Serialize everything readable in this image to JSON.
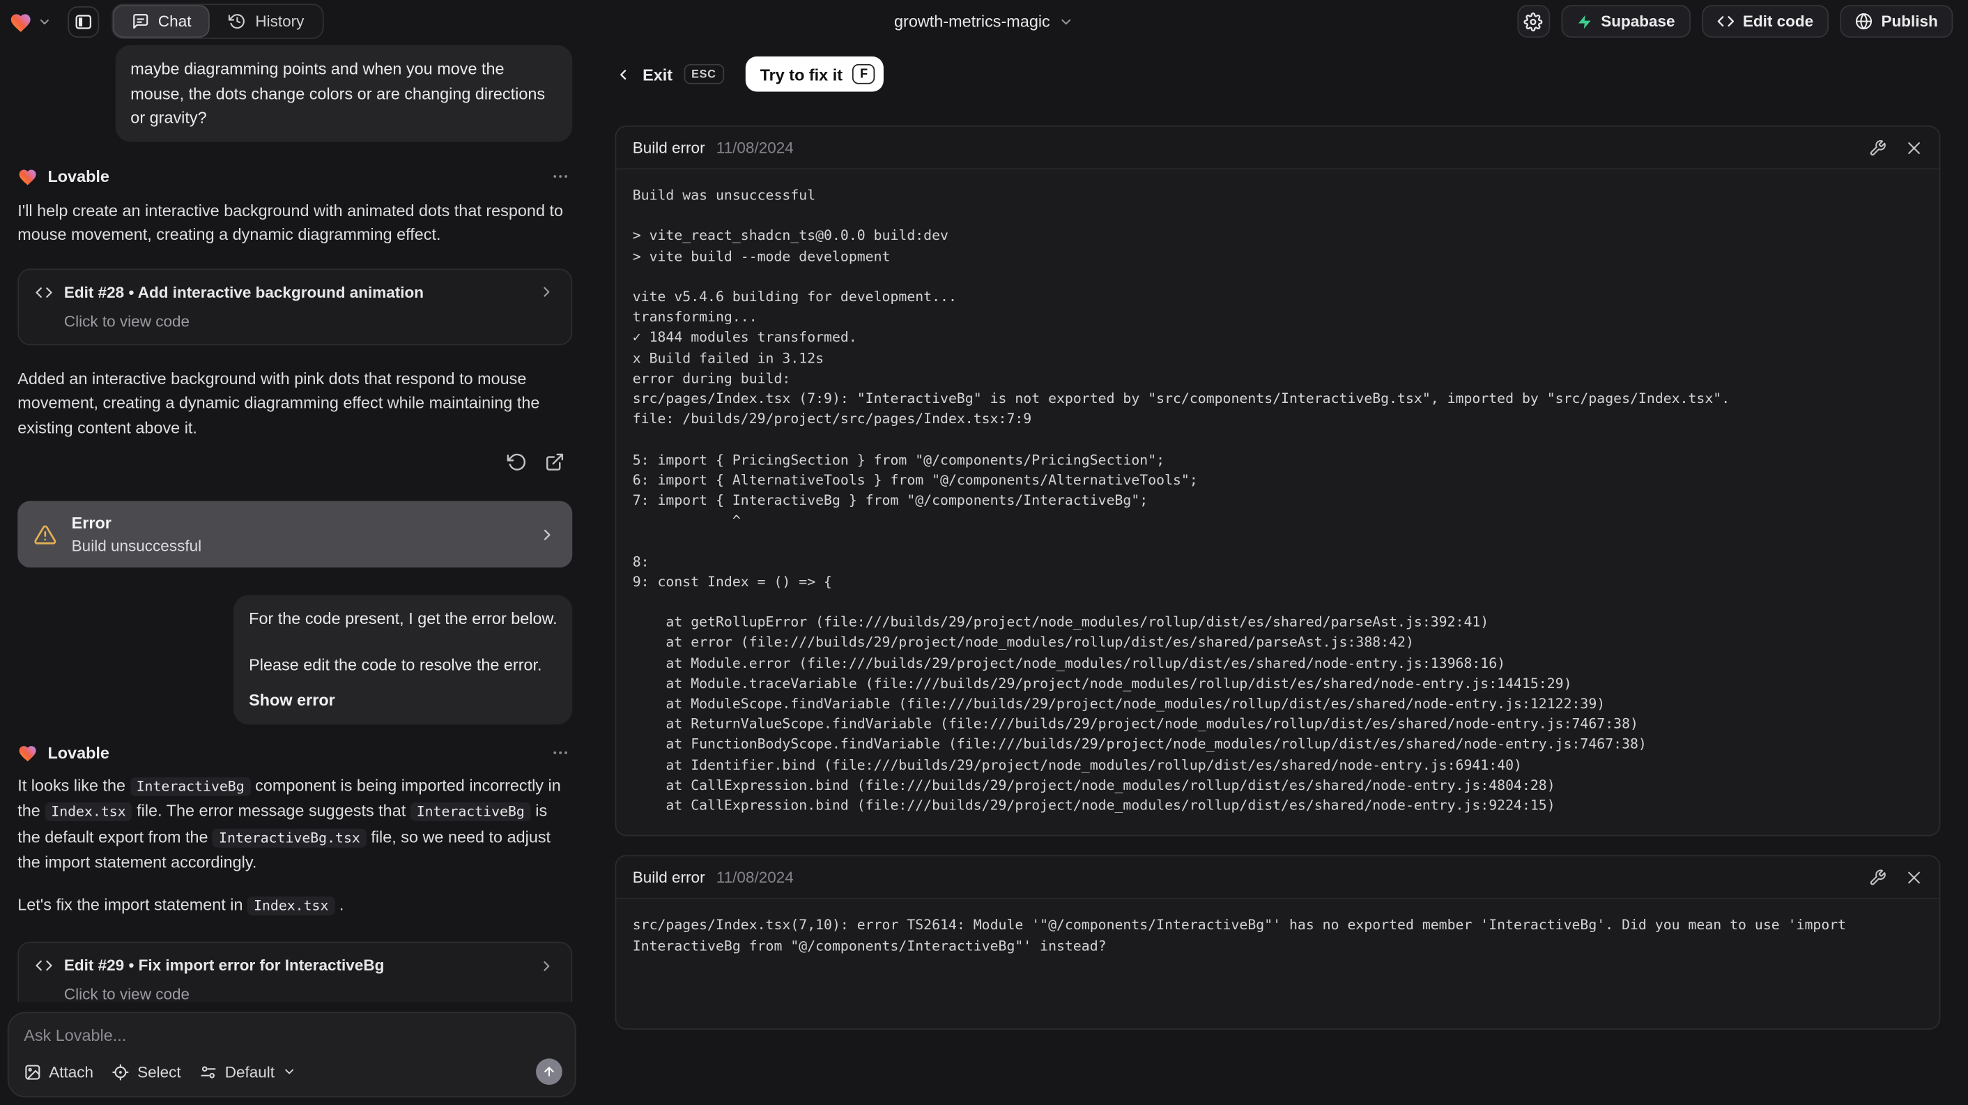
{
  "topbar": {
    "project_name": "growth-metrics-magic",
    "tabs": {
      "chat": "Chat",
      "history": "History"
    },
    "supabase_label": "Supabase",
    "edit_code_label": "Edit code",
    "publish_label": "Publish"
  },
  "colors": {
    "supabase_green": "#3ecf8e",
    "warning_yellow": "#e5b054",
    "fix_button_bg": "#ffffff"
  },
  "icons": {
    "logo": "heart-icon",
    "sidebar": "panel-left-icon",
    "chat_tab": "chat-bubble-icon",
    "history_tab": "history-icon",
    "settings": "gear-icon",
    "supabase": "zap-icon",
    "edit_code": "code-icon",
    "publish": "globe-icon",
    "repair": "wrench-icon",
    "close": "x-icon"
  },
  "chat": {
    "assistant_name": "Lovable",
    "user_message_1": "maybe diagramming points and when you move the mouse, the dots change colors or are changing directions or gravity?",
    "assistant_intro": "I'll help create an interactive background with animated dots that respond to mouse movement, creating a dynamic diagramming effect.",
    "edit_card_1": {
      "title": "Edit #28 • Add interactive background animation",
      "subtitle": "Click to view code"
    },
    "assistant_summary": "Added an interactive background with pink dots that respond to mouse movement, creating a dynamic diagramming effect while maintaining the existing content above it.",
    "error_card": {
      "title": "Error",
      "subtitle": "Build unsuccessful"
    },
    "user_message_2": {
      "para1": "For the code present, I get the error below.",
      "para2": "Please edit the code to resolve the error.",
      "action": "Show error"
    },
    "assistant_fix_explanation": [
      {
        "t": "text",
        "v": "It looks like the "
      },
      {
        "t": "code",
        "v": "InteractiveBg"
      },
      {
        "t": "text",
        "v": " component is being imported incorrectly in the "
      },
      {
        "t": "code",
        "v": "Index.tsx"
      },
      {
        "t": "text",
        "v": " file. The error message suggests that "
      },
      {
        "t": "code",
        "v": "InteractiveBg"
      },
      {
        "t": "text",
        "v": " is the default export from the "
      },
      {
        "t": "code",
        "v": "InteractiveBg.tsx"
      },
      {
        "t": "text",
        "v": " file, so we need to adjust the import statement accordingly."
      }
    ],
    "assistant_fix_line": [
      {
        "t": "text",
        "v": "Let's fix the import statement in "
      },
      {
        "t": "code",
        "v": "Index.tsx"
      },
      {
        "t": "text",
        "v": " ."
      }
    ],
    "edit_card_2": {
      "title": "Edit #29 • Fix import error for InteractiveBg",
      "subtitle": "Click to view code"
    },
    "composer": {
      "placeholder": "Ask Lovable...",
      "attach_label": "Attach",
      "select_label": "Select",
      "mode_label": "Default"
    }
  },
  "error_panel": {
    "exit_label": "Exit",
    "esc_key": "ESC",
    "fix_label": "Try to fix it",
    "fix_key": "F",
    "cards": [
      {
        "title": "Build error",
        "date": "11/08/2024",
        "log": [
          "Build was unsuccessful",
          "",
          "> vite_react_shadcn_ts@0.0.0 build:dev",
          "> vite build --mode development",
          "",
          "vite v5.4.6 building for development...",
          "transforming...",
          "✓ 1844 modules transformed.",
          "x Build failed in 3.12s",
          "error during build:",
          "src/pages/Index.tsx (7:9): \"InteractiveBg\" is not exported by \"src/components/InteractiveBg.tsx\", imported by \"src/pages/Index.tsx\".",
          "file: /builds/29/project/src/pages/Index.tsx:7:9",
          "",
          "5: import { PricingSection } from \"@/components/PricingSection\";",
          "6: import { AlternativeTools } from \"@/components/AlternativeTools\";",
          "7: import { InteractiveBg } from \"@/components/InteractiveBg\";",
          "            ^",
          "",
          "8: ",
          "9: const Index = () => {",
          "",
          "    at getRollupError (file:///builds/29/project/node_modules/rollup/dist/es/shared/parseAst.js:392:41)",
          "    at error (file:///builds/29/project/node_modules/rollup/dist/es/shared/parseAst.js:388:42)",
          "    at Module.error (file:///builds/29/project/node_modules/rollup/dist/es/shared/node-entry.js:13968:16)",
          "    at Module.traceVariable (file:///builds/29/project/node_modules/rollup/dist/es/shared/node-entry.js:14415:29)",
          "    at ModuleScope.findVariable (file:///builds/29/project/node_modules/rollup/dist/es/shared/node-entry.js:12122:39)",
          "    at ReturnValueScope.findVariable (file:///builds/29/project/node_modules/rollup/dist/es/shared/node-entry.js:7467:38)",
          "    at FunctionBodyScope.findVariable (file:///builds/29/project/node_modules/rollup/dist/es/shared/node-entry.js:7467:38)",
          "    at Identifier.bind (file:///builds/29/project/node_modules/rollup/dist/es/shared/node-entry.js:6941:40)",
          "    at CallExpression.bind (file:///builds/29/project/node_modules/rollup/dist/es/shared/node-entry.js:4804:28)",
          "    at CallExpression.bind (file:///builds/29/project/node_modules/rollup/dist/es/shared/node-entry.js:9224:15)"
        ]
      },
      {
        "title": "Build error",
        "date": "11/08/2024",
        "log": [
          "src/pages/Index.tsx(7,10): error TS2614: Module '\"@/components/InteractiveBg\"' has no exported member 'InteractiveBg'. Did you mean to use 'import InteractiveBg from \"@/components/InteractiveBg\"' instead?"
        ]
      }
    ]
  }
}
